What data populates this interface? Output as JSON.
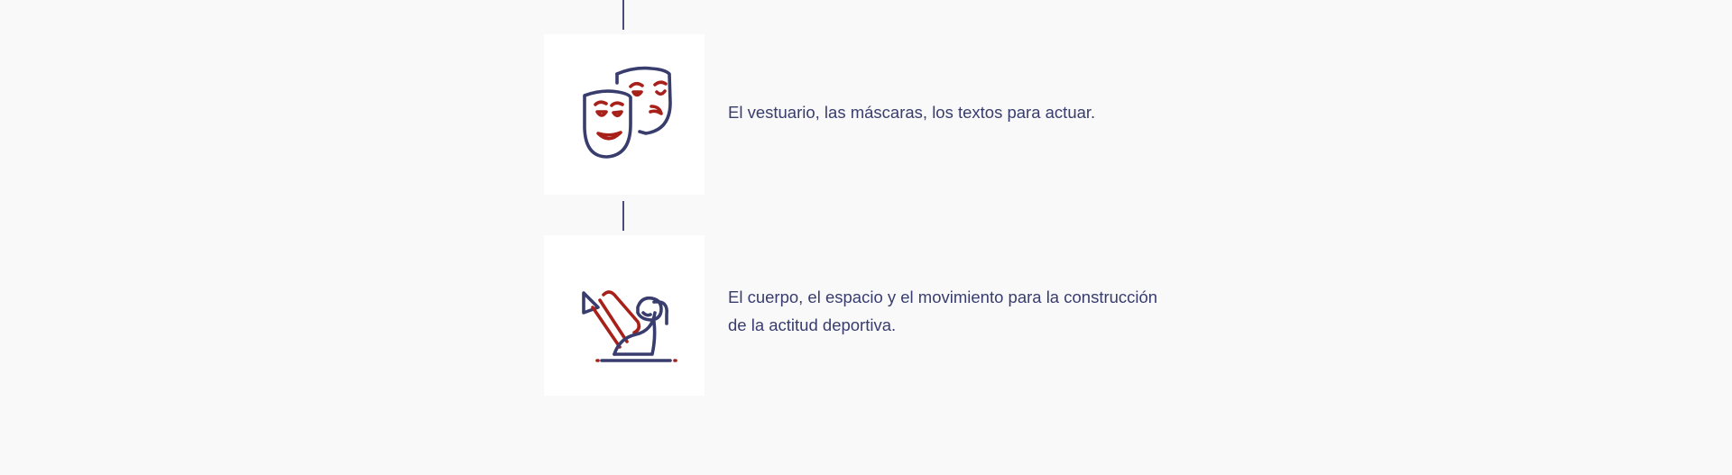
{
  "colors": {
    "background": "#f9f9f9",
    "tile": "#ffffff",
    "connector": "#4a4f7a",
    "icon_primary": "#383d6e",
    "icon_accent": "#a8201a",
    "text": "#383d6e"
  },
  "items": [
    {
      "icon": "theater-masks-icon",
      "text": "El vestuario, las máscaras, los textos para actuar."
    },
    {
      "icon": "gymnast-icon",
      "text": "El cuerpo, el espacio y el movimiento para la construcción de la actitud deportiva."
    }
  ]
}
